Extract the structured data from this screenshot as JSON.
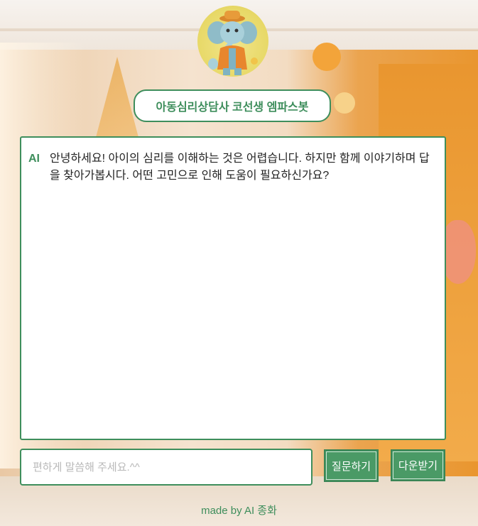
{
  "header": {
    "title": "아동심리상담사 코선생 엠파스봇"
  },
  "chat": {
    "messages": [
      {
        "sender": "AI",
        "text": "안녕하세요! 아이의 심리를 이해하는 것은 어렵습니다. 하지만 함께 이야기하며 답을 찾아가봅시다. 어떤 고민으로 인해 도움이 필요하신가요?"
      }
    ]
  },
  "composer": {
    "placeholder": "편하게 말씀해 주세요.^^",
    "value": "",
    "ask_label": "질문하기",
    "download_label": "다운받기"
  },
  "footer": {
    "credit": "made by AI 종화"
  },
  "colors": {
    "accent": "#3e8e5c",
    "button": "#4a9a66",
    "avatar_bg": "#e7d866"
  },
  "icons": {
    "avatar": "elephant-mascot-icon"
  }
}
